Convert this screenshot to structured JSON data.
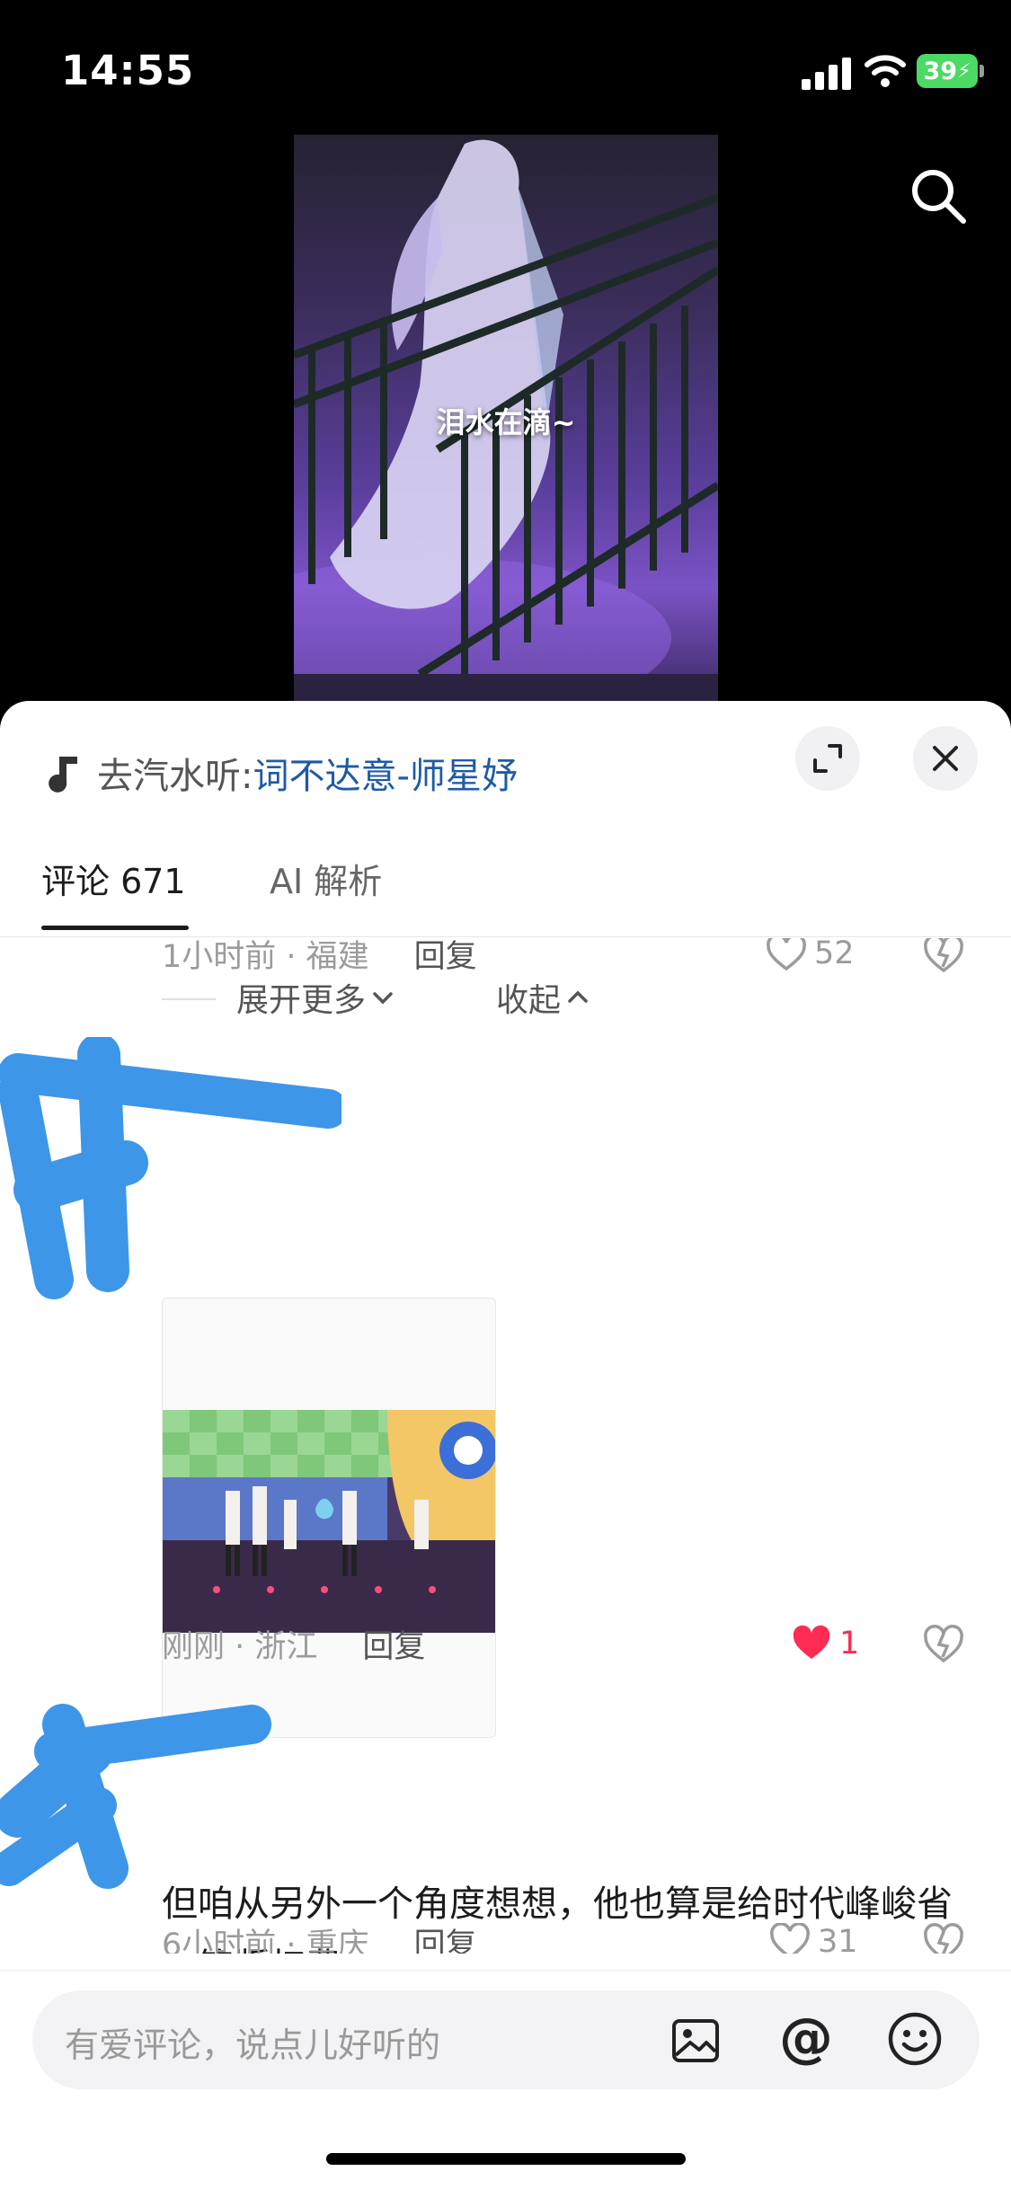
{
  "status_bar": {
    "time": "14:55",
    "battery": "39"
  },
  "video": {
    "caption": "泪水在滴~"
  },
  "music_bar": {
    "prefix": "去汽水听:",
    "song": "词不达意-师星妤"
  },
  "tabs": {
    "comments": "评论 671",
    "ai": "AI 解析"
  },
  "comments": {
    "first": {
      "meta": "1小时前 · 福建",
      "reply": "回复",
      "likes": "52"
    },
    "thread_controls": {
      "expand_more": "展开更多",
      "collapse": "收起"
    },
    "second": {
      "meta": "刚刚 · 浙江",
      "reply": "回复",
      "likes": "1",
      "liked": true,
      "like_color": "#fe2c55"
    },
    "third": {
      "text": "但咱从另外一个角度想想，他也算是给时代峰峻省一笔版权费",
      "meta": "6小时前 · 重庆",
      "reply": "回复",
      "likes": "31"
    }
  },
  "input_bar": {
    "placeholder": "有爱评论，说点儿好听的",
    "icons": [
      "image-icon",
      "at-icon",
      "emoji-icon"
    ]
  },
  "colors": {
    "accent_link": "#1f5aa5",
    "scribble": "#3d96e8",
    "battery": "#4cd964"
  }
}
